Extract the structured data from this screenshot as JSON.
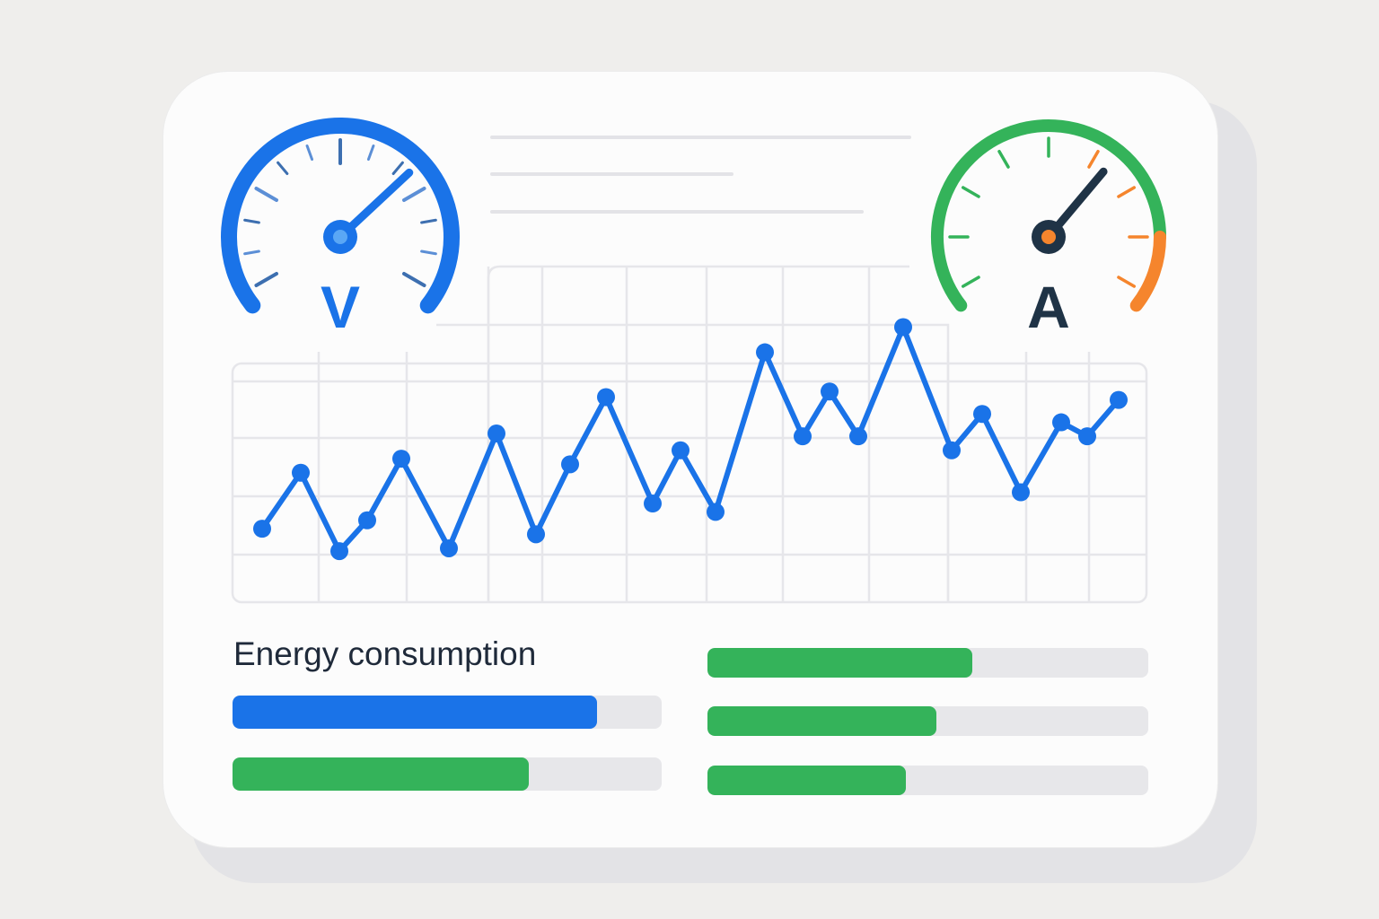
{
  "colors": {
    "blue": "#1a73e8",
    "green": "#34b35a",
    "orange": "#f5852d",
    "dark": "#1f3346",
    "grid": "#e6e6ea"
  },
  "gauges": [
    {
      "unit": "V",
      "color": "#1a73e8",
      "icon": "voltmeter-gauge"
    },
    {
      "unit": "A",
      "color": "#34b35a",
      "icon": "ammeter-gauge"
    }
  ],
  "energy": {
    "title": "Energy consumption",
    "bars_left": [
      {
        "fraction": 0.85,
        "color": "#1a73e8"
      },
      {
        "fraction": 0.69,
        "color": "#34b35a"
      }
    ],
    "bars_right": [
      {
        "fraction": 0.6,
        "color": "#34b35a"
      },
      {
        "fraction": 0.52,
        "color": "#34b35a"
      },
      {
        "fraction": 0.45,
        "color": "#34b35a"
      }
    ]
  },
  "chart_data": {
    "type": "line",
    "title": "",
    "xlabel": "",
    "ylabel": "",
    "grid": true,
    "series": [
      {
        "color": "#1a73e8",
        "values": [
          24,
          44,
          16,
          27,
          49,
          17,
          58,
          22,
          47,
          71,
          33,
          52,
          30,
          87,
          57,
          73,
          57,
          96,
          52,
          65,
          37,
          62,
          57,
          70
        ]
      }
    ]
  }
}
